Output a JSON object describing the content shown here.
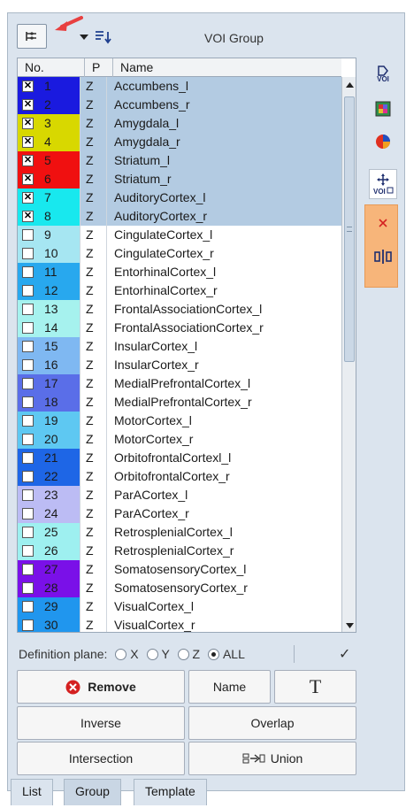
{
  "toolbar": {
    "title": "VOI Group",
    "icons": [
      "group-settings-icon",
      "dropdown-arrow-icon",
      "sort-icon"
    ]
  },
  "table": {
    "columns": [
      "No.",
      "P",
      "Name"
    ],
    "rows": [
      {
        "no": "1",
        "p": "Z",
        "name": "Accumbens_l",
        "checked": true,
        "color": "#1a1adf",
        "selected": true
      },
      {
        "no": "2",
        "p": "Z",
        "name": "Accumbens_r",
        "checked": true,
        "color": "#1a1adf",
        "selected": true
      },
      {
        "no": "3",
        "p": "Z",
        "name": "Amygdala_l",
        "checked": true,
        "color": "#d8d800",
        "selected": true
      },
      {
        "no": "4",
        "p": "Z",
        "name": "Amygdala_r",
        "checked": true,
        "color": "#d8d800",
        "selected": true
      },
      {
        "no": "5",
        "p": "Z",
        "name": "Striatum_l",
        "checked": true,
        "color": "#f01010",
        "selected": true
      },
      {
        "no": "6",
        "p": "Z",
        "name": "Striatum_r",
        "checked": true,
        "color": "#f01010",
        "selected": true
      },
      {
        "no": "7",
        "p": "Z",
        "name": "AuditoryCortex_l",
        "checked": true,
        "color": "#18e8ee",
        "selected": true
      },
      {
        "no": "8",
        "p": "Z",
        "name": "AuditoryCortex_r",
        "checked": true,
        "color": "#18e8ee",
        "selected": true
      },
      {
        "no": "9",
        "p": "Z",
        "name": "CingulateCortex_l",
        "checked": false,
        "color": "#a6e6f2",
        "selected": false
      },
      {
        "no": "10",
        "p": "Z",
        "name": "CingulateCortex_r",
        "checked": false,
        "color": "#a6e6f2",
        "selected": false
      },
      {
        "no": "11",
        "p": "Z",
        "name": "EntorhinalCortex_l",
        "checked": false,
        "color": "#28a8ee",
        "selected": false
      },
      {
        "no": "12",
        "p": "Z",
        "name": "EntorhinalCortex_r",
        "checked": false,
        "color": "#28a8ee",
        "selected": false
      },
      {
        "no": "13",
        "p": "Z",
        "name": "FrontalAssociationCortex_l",
        "checked": false,
        "color": "#a6f2ee",
        "selected": false
      },
      {
        "no": "14",
        "p": "Z",
        "name": "FrontalAssociationCortex_r",
        "checked": false,
        "color": "#a6f2ee",
        "selected": false
      },
      {
        "no": "15",
        "p": "Z",
        "name": "InsularCortex_l",
        "checked": false,
        "color": "#7fb8f2",
        "selected": false
      },
      {
        "no": "16",
        "p": "Z",
        "name": "InsularCortex_r",
        "checked": false,
        "color": "#7fb8f2",
        "selected": false
      },
      {
        "no": "17",
        "p": "Z",
        "name": "MedialPrefrontalCortex_l",
        "checked": false,
        "color": "#5a6ee8",
        "selected": false
      },
      {
        "no": "18",
        "p": "Z",
        "name": "MedialPrefrontalCortex_r",
        "checked": false,
        "color": "#5a6ee8",
        "selected": false
      },
      {
        "no": "19",
        "p": "Z",
        "name": "MotorCortex_l",
        "checked": false,
        "color": "#5ec8f2",
        "selected": false
      },
      {
        "no": "20",
        "p": "Z",
        "name": "MotorCortex_r",
        "checked": false,
        "color": "#5ec8f2",
        "selected": false
      },
      {
        "no": "21",
        "p": "Z",
        "name": "OrbitofrontalCortexl_l",
        "checked": false,
        "color": "#1e66e6",
        "selected": false
      },
      {
        "no": "22",
        "p": "Z",
        "name": "OrbitofrontalCortex_r",
        "checked": false,
        "color": "#1e66e6",
        "selected": false
      },
      {
        "no": "23",
        "p": "Z",
        "name": "ParACortex_l",
        "checked": false,
        "color": "#bcbcf4",
        "selected": false
      },
      {
        "no": "24",
        "p": "Z",
        "name": "ParACortex_r",
        "checked": false,
        "color": "#bcbcf4",
        "selected": false
      },
      {
        "no": "25",
        "p": "Z",
        "name": "RetrosplenialCortex_l",
        "checked": false,
        "color": "#9ef0f0",
        "selected": false
      },
      {
        "no": "26",
        "p": "Z",
        "name": "RetrosplenialCortex_r",
        "checked": false,
        "color": "#9ef0f0",
        "selected": false
      },
      {
        "no": "27",
        "p": "Z",
        "name": "SomatosensoryCortex_l",
        "checked": false,
        "color": "#7a10e8",
        "selected": false
      },
      {
        "no": "28",
        "p": "Z",
        "name": "SomatosensoryCortex_r",
        "checked": false,
        "color": "#7a10e8",
        "selected": false
      },
      {
        "no": "29",
        "p": "Z",
        "name": "VisualCortex_l",
        "checked": false,
        "color": "#2096ee",
        "selected": false
      },
      {
        "no": "30",
        "p": "Z",
        "name": "VisualCortex_r",
        "checked": false,
        "color": "#2096ee",
        "selected": false
      }
    ]
  },
  "side_toolbar": {
    "voi_label": "VOI",
    "icons": [
      "voi-icon",
      "colormap-icon",
      "pie-chart-icon",
      "move-voi-icon",
      "close-icon",
      "split-icon"
    ]
  },
  "definition_plane": {
    "label": "Definition plane:",
    "options": [
      "X",
      "Y",
      "Z",
      "ALL"
    ],
    "selected": "ALL"
  },
  "buttons": {
    "remove": "Remove",
    "name": "Name",
    "text": "T",
    "inverse": "Inverse",
    "overlap": "Overlap",
    "intersection": "Intersection",
    "union": "Union"
  },
  "tabs": [
    "List",
    "Group",
    "Template"
  ],
  "active_tab": "Group",
  "colors": {
    "selection": "#b3cbe2",
    "side_panel": "#f7b57a",
    "pointer_arrow": "#e84040",
    "remove_icon": "#d42020"
  }
}
